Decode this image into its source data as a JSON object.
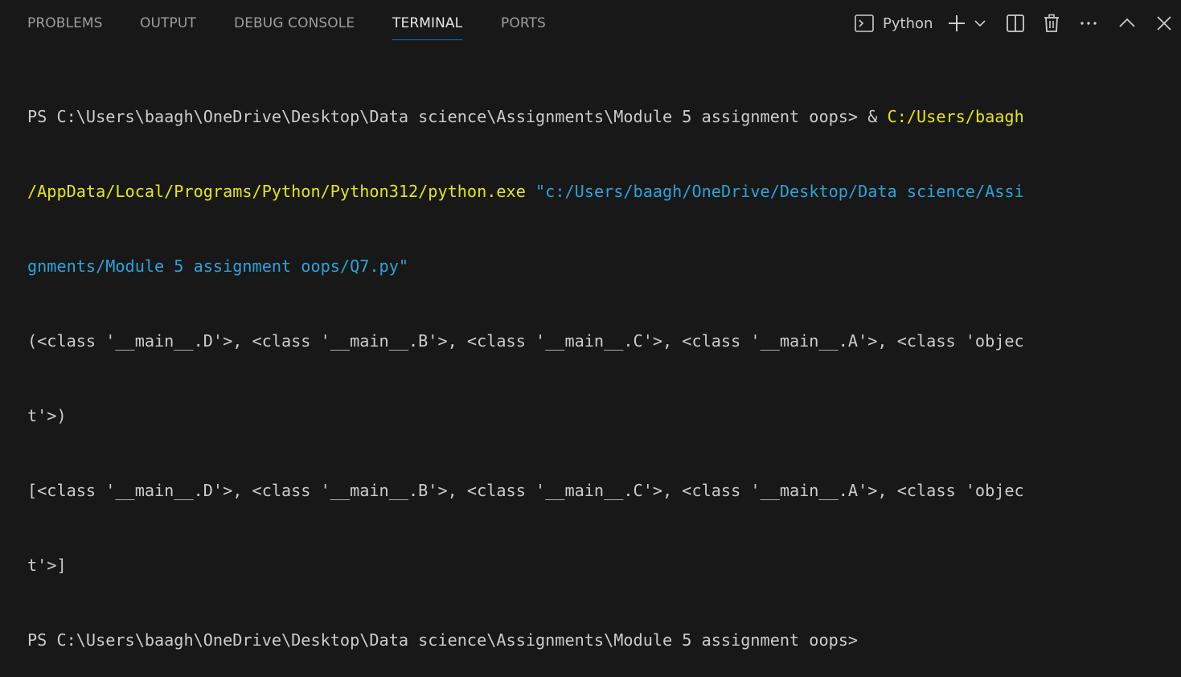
{
  "tabs": [
    {
      "label": "PROBLEMS",
      "active": false
    },
    {
      "label": "OUTPUT",
      "active": false
    },
    {
      "label": "DEBUG CONSOLE",
      "active": false
    },
    {
      "label": "TERMINAL",
      "active": true
    },
    {
      "label": "PORTS",
      "active": false
    }
  ],
  "toolbar": {
    "shell_icon": "terminal-icon",
    "shell_name": "Python",
    "new_terminal_icon": "plus-icon",
    "dropdown_icon": "chevron-down-icon",
    "split_icon": "split-icon",
    "trash_icon": "trash-icon",
    "more_icon": "more-icon",
    "maximize_icon": "chevron-up-icon",
    "close_icon": "close-icon"
  },
  "colors": {
    "background": "#181818",
    "active_tab_underline": "#0078d4",
    "command_path": "#e5e510",
    "string_arg": "#2aa3d8",
    "text": "#cccccc"
  },
  "terminal": {
    "line1": {
      "prompt": "PS C:\\Users\\baagh\\OneDrive\\Desktop\\Data science\\Assignments\\Module 5 assignment oops> ",
      "amp": "& ",
      "exe_part1": "C:/Users/baagh"
    },
    "line2": {
      "exe_part2": "/AppData/Local/Programs/Python/Python312/python.exe",
      "space": " ",
      "arg_part1": "\"c:/Users/baagh/OneDrive/Desktop/Data science/Assi"
    },
    "line3": {
      "arg_part2": "gnments/Module 5 assignment oops/Q7.py\""
    },
    "line4": "(<class '__main__.D'>, <class '__main__.B'>, <class '__main__.C'>, <class '__main__.A'>, <class 'objec",
    "line5": "t'>)",
    "line6": "[<class '__main__.D'>, <class '__main__.B'>, <class '__main__.C'>, <class '__main__.A'>, <class 'objec",
    "line7": "t'>]",
    "line8": "PS C:\\Users\\baagh\\OneDrive\\Desktop\\Data science\\Assignments\\Module 5 assignment oops>"
  }
}
